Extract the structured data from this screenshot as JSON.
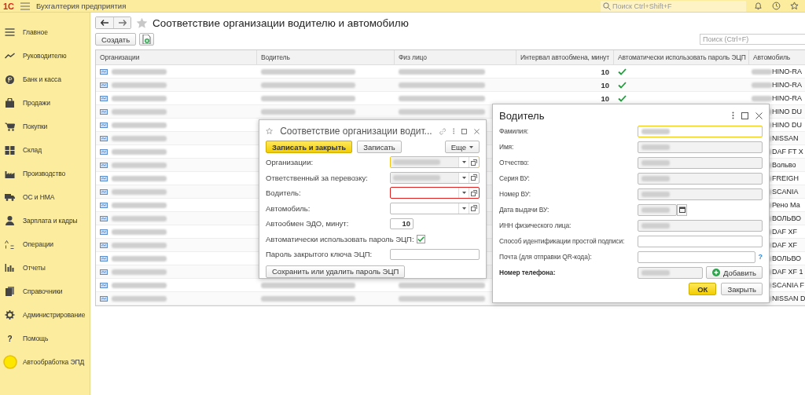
{
  "app": {
    "logo": "1С",
    "title": "Бухгалтерия предприятия",
    "search_placeholder": "Поиск Ctrl+Shift+F"
  },
  "sidebar": [
    {
      "label": "Главное"
    },
    {
      "label": "Руководителю"
    },
    {
      "label": "Банк и касса"
    },
    {
      "label": "Продажи"
    },
    {
      "label": "Покупки"
    },
    {
      "label": "Склад"
    },
    {
      "label": "Производство"
    },
    {
      "label": "ОС и НМА"
    },
    {
      "label": "Зарплата и кадры"
    },
    {
      "label": "Операции"
    },
    {
      "label": "Отчеты"
    },
    {
      "label": "Справочники"
    },
    {
      "label": "Администрирование"
    },
    {
      "label": "Помощь",
      "glyph": "?"
    },
    {
      "label": "Автообработка ЭПД"
    }
  ],
  "page": {
    "title": "Соответствие организации водителю и автомобилю",
    "create_button": "Создать",
    "search_placeholder": "Поиск (Ctrl+F)"
  },
  "table": {
    "columns": [
      "Организации",
      "Водитель",
      "Физ лицо",
      "Интервал автообмена, минут",
      "Автоматически использовать пароль ЭЦП",
      "Автомобиль"
    ],
    "rows": [
      {
        "interval": "10",
        "auto_password": true,
        "vehicle": "HINO-RA"
      },
      {
        "interval": "10",
        "auto_password": true,
        "vehicle": "HINO-RA"
      },
      {
        "interval": "10",
        "auto_password": true,
        "vehicle": "HINO-RA"
      },
      {
        "vehicle": "HINO DU"
      },
      {
        "vehicle": "HINO DU"
      },
      {
        "vehicle": "NISSAN"
      },
      {
        "vehicle": "DAF FT X"
      },
      {
        "vehicle": "Вольво"
      },
      {
        "vehicle": "FREIGH"
      },
      {
        "vehicle": "SCANIA"
      },
      {
        "vehicle": "Рено Ма"
      },
      {
        "vehicle": "ВОЛЬВО"
      },
      {
        "vehicle": "DAF XF"
      },
      {
        "vehicle": "DAF XF"
      },
      {
        "vehicle": "ВОЛЬВО"
      },
      {
        "vehicle": "DAF XF 1"
      },
      {
        "vehicle": "SCANIA F"
      },
      {
        "vehicle": "NISSAN D"
      }
    ]
  },
  "match_dialog": {
    "title": "Соответствие организации водит...",
    "save_close_button": "Записать и закрыть",
    "save_button": "Записать",
    "more_button": "Еще",
    "fields": [
      {
        "kind": "select",
        "label": "Организации:",
        "focused": true,
        "error": false,
        "redacted": true
      },
      {
        "kind": "select",
        "label": "Ответственный за перевозку:",
        "focused": false,
        "error": false,
        "redacted": true
      },
      {
        "kind": "select",
        "label": "Водитель:",
        "focused": false,
        "error": true,
        "redacted": false
      },
      {
        "kind": "select",
        "label": "Автомобиль:",
        "focused": false,
        "error": false,
        "redacted": false
      },
      {
        "kind": "number",
        "label": "Автообмен ЭДО, минут:",
        "value": "10"
      },
      {
        "kind": "checkbox",
        "label": "Автоматически использовать пароль ЭЦП:",
        "checked": true
      },
      {
        "kind": "text",
        "label": "Пароль закрытого ключа ЭЦП:"
      }
    ],
    "bottom_button": "Сохранить или удалить пароль ЭЦП"
  },
  "driver_dialog": {
    "title": "Водитель",
    "fields": [
      {
        "kind": "text",
        "label": "Фамилия:",
        "focused": true,
        "redacted": true
      },
      {
        "kind": "text",
        "label": "Имя:",
        "focused": false,
        "redacted": true
      },
      {
        "kind": "text",
        "label": "Отчество:",
        "focused": false,
        "redacted": true
      },
      {
        "kind": "text",
        "label": "Серия ВУ:",
        "focused": false,
        "redacted": true
      },
      {
        "kind": "text",
        "label": "Номер ВУ:",
        "focused": false,
        "redacted": true
      },
      {
        "kind": "date",
        "label": "Дата выдачи ВУ:",
        "focused": false,
        "redacted": true
      },
      {
        "kind": "text",
        "label": "ИНН физического лица:",
        "focused": false,
        "redacted": true
      },
      {
        "kind": "text",
        "label": "Способ идентификации простой подписи:",
        "focused": false,
        "redacted": false
      },
      {
        "kind": "text",
        "label": "Почта (для отправки QR-кода):",
        "focused": false,
        "redacted": false,
        "help": "?"
      },
      {
        "kind": "phone",
        "label": "Номер телефона:",
        "focused": false,
        "redacted": true,
        "add_button": "Добавить"
      }
    ],
    "ok_button": "ОК",
    "close_button": "Закрыть"
  }
}
